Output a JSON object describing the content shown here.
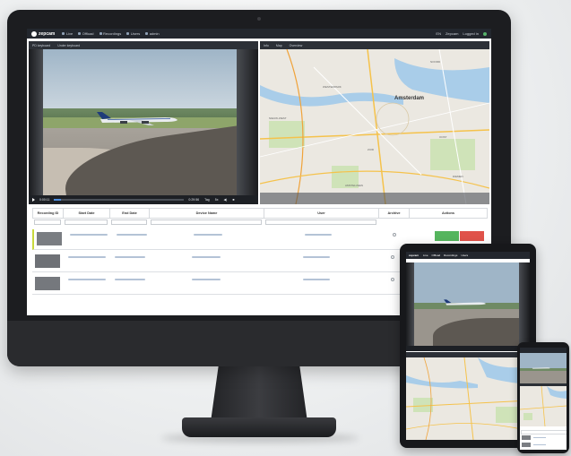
{
  "app": {
    "brand": "zepcam",
    "nav": [
      {
        "label": "Live",
        "icon": "grid-icon"
      },
      {
        "label": "Offload",
        "icon": "upload-icon"
      },
      {
        "label": "Recordings",
        "icon": "recordings-icon"
      },
      {
        "label": "Users",
        "icon": "users-icon"
      },
      {
        "label": "admin",
        "icon": "gear-icon"
      }
    ],
    "user": {
      "lang": "EN",
      "name": "Zepcam",
      "status": "Logged in"
    }
  },
  "video_panel": {
    "tabs": [
      "PD keyboard",
      "Under keyboard"
    ],
    "current_time": "0:00:11",
    "end_time": "0:29:56",
    "progress": 0.05,
    "buttons": [
      "Tag",
      "5x"
    ]
  },
  "map_panel": {
    "tabs": [
      "Info",
      "Map",
      "Overview"
    ],
    "city_label": "Amsterdam",
    "districts": [
      "WESTERPARK",
      "NOORD",
      "OOST",
      "NIEUW-WEST",
      "ZUID",
      "AMSTELVEEN",
      "DIEMEN"
    ]
  },
  "table": {
    "columns": [
      "Recording ID",
      "Start Date",
      "End Date",
      "Device Name",
      "User",
      "Archive",
      "Actions"
    ],
    "rows": [
      {
        "selected": true,
        "has_actions": true
      },
      {
        "selected": false,
        "has_actions": false
      },
      {
        "selected": false,
        "has_actions": false
      }
    ]
  },
  "colors": {
    "accent_blue": "#4f8fe0",
    "action_green": "#55b55e",
    "action_red": "#e0524a",
    "selected_row": "#c8d93d",
    "topbar": "#23272e"
  }
}
